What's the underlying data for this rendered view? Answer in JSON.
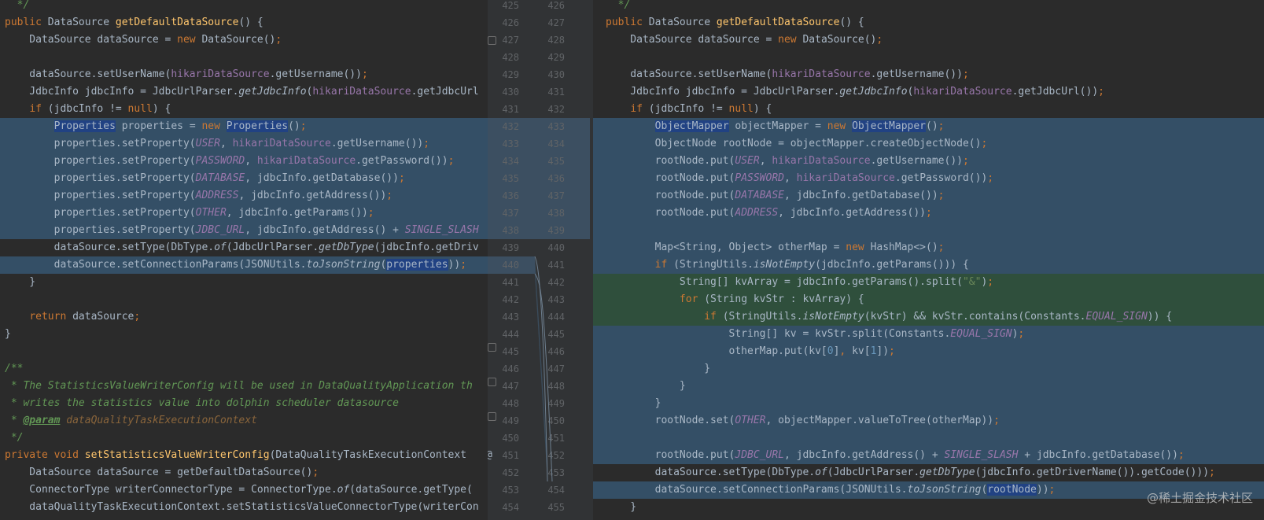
{
  "colors": {
    "background": "#2b2b2b",
    "gutter": "#313335",
    "changed_block": "#344f66",
    "inserted_block": "#2f4f3c",
    "keyword": "#cc7832",
    "method": "#ffc66d",
    "field": "#9876aa",
    "comment": "#629755"
  },
  "left_code": [
    "  */",
    "public DataSource getDefaultDataSource() {",
    "    DataSource dataSource = new DataSource();",
    "",
    "    dataSource.setUserName(hikariDataSource.getUsername());",
    "    JdbcInfo jdbcInfo = JdbcUrlParser.getJdbcInfo(hikariDataSource.getJdbcUrl",
    "    if (jdbcInfo != null) {",
    "        Properties properties = new Properties();",
    "        properties.setProperty(USER, hikariDataSource.getUsername());",
    "        properties.setProperty(PASSWORD, hikariDataSource.getPassword());",
    "        properties.setProperty(DATABASE, jdbcInfo.getDatabase());",
    "        properties.setProperty(ADDRESS, jdbcInfo.getAddress());",
    "        properties.setProperty(OTHER, jdbcInfo.getParams());",
    "        properties.setProperty(JDBC_URL, jdbcInfo.getAddress() + SINGLE_SLASH",
    "        dataSource.setType(DbType.of(JdbcUrlParser.getDbType(jdbcInfo.getDriv",
    "        dataSource.setConnectionParams(JSONUtils.toJsonString(properties));",
    "    }",
    "",
    "    return dataSource;",
    "}",
    "",
    "/**",
    " * The StatisticsValueWriterConfig will be used in DataQualityApplication th",
    " * writes the statistics value into dolphin scheduler datasource",
    " * @param dataQualityTaskExecutionContext",
    " */",
    "private void setStatisticsValueWriterConfig(DataQualityTaskExecutionContext",
    "    DataSource dataSource = getDefaultDataSource();",
    "    ConnectorType writerConnectorType = ConnectorType.of(dataSource.getType(",
    "    dataQualityTaskExecutionContext.setStatisticsValueConnectorType(writerCon"
  ],
  "right_code": [
    "  */",
    "public DataSource getDefaultDataSource() {",
    "    DataSource dataSource = new DataSource();",
    "",
    "    dataSource.setUserName(hikariDataSource.getUsername());",
    "    JdbcInfo jdbcInfo = JdbcUrlParser.getJdbcInfo(hikariDataSource.getJdbcUrl());",
    "    if (jdbcInfo != null) {",
    "        ObjectMapper objectMapper = new ObjectMapper();",
    "        ObjectNode rootNode = objectMapper.createObjectNode();",
    "        rootNode.put(USER, hikariDataSource.getUsername());",
    "        rootNode.put(PASSWORD, hikariDataSource.getPassword());",
    "        rootNode.put(DATABASE, jdbcInfo.getDatabase());",
    "        rootNode.put(ADDRESS, jdbcInfo.getAddress());",
    "",
    "        Map<String, Object> otherMap = new HashMap<>();",
    "        if (StringUtils.isNotEmpty(jdbcInfo.getParams())) {",
    "            String[] kvArray = jdbcInfo.getParams().split(\"&\");",
    "            for (String kvStr : kvArray) {",
    "                if (StringUtils.isNotEmpty(kvStr) && kvStr.contains(Constants.EQUAL_SIGN)) {",
    "                    String[] kv = kvStr.split(Constants.EQUAL_SIGN);",
    "                    otherMap.put(kv[0], kv[1]);",
    "                }",
    "            }",
    "        }",
    "        rootNode.set(OTHER, objectMapper.valueToTree(otherMap));",
    "",
    "        rootNode.put(JDBC_URL, jdbcInfo.getAddress() + SINGLE_SLASH + jdbcInfo.getDatabase());",
    "        dataSource.setType(DbType.of(JdbcUrlParser.getDbType(jdbcInfo.getDriverName()).getCode()));",
    "        dataSource.setConnectionParams(JSONUtils.toJsonString(rootNode));",
    "    }"
  ],
  "left_line_numbers": [
    "425",
    "426",
    "427",
    "428",
    "429",
    "430",
    "431",
    "432",
    "433",
    "434",
    "435",
    "436",
    "437",
    "438",
    "439",
    "440",
    "441",
    "442",
    "443",
    "444",
    "445",
    "446",
    "447",
    "448",
    "449",
    "450",
    "451",
    "452",
    "453",
    "454"
  ],
  "right_line_numbers": [
    "426",
    "427",
    "428",
    "429",
    "430",
    "431",
    "432",
    "433",
    "434",
    "435",
    "436",
    "437",
    "438",
    "439",
    "440",
    "441",
    "442",
    "443",
    "444",
    "445",
    "446",
    "447",
    "448",
    "449",
    "450",
    "451",
    "452",
    "453",
    "454",
    "455"
  ],
  "gutter_marker": "@",
  "watermark": "@稀土掘金技术社区"
}
